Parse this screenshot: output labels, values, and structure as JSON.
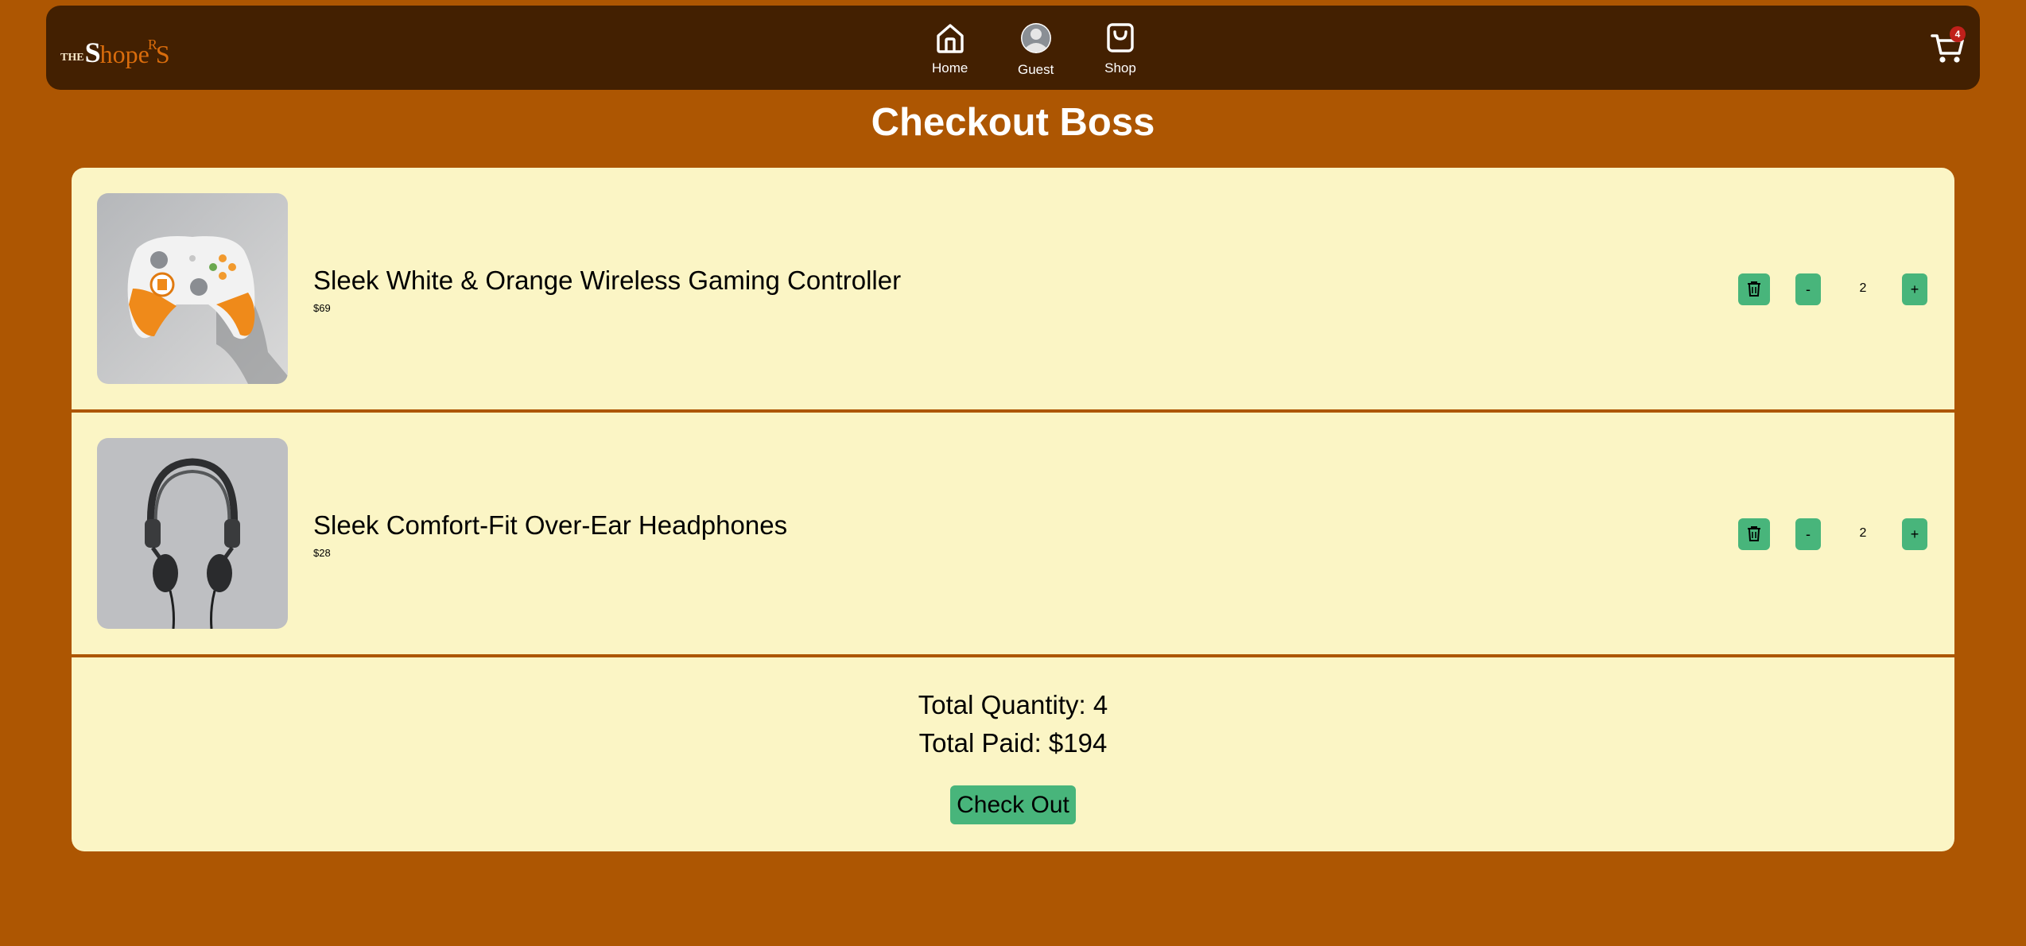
{
  "nav": {
    "logo": {
      "the": "THE",
      "s1": "S",
      "rest": "hope",
      "sup": "R",
      "s2": "S"
    },
    "items": [
      {
        "label": "Home",
        "icon": "home-icon"
      },
      {
        "label": "Guest",
        "icon": "user-avatar-icon"
      },
      {
        "label": "Shop",
        "icon": "shopping-bag-icon"
      }
    ],
    "cart": {
      "icon": "cart-icon",
      "badge": "4"
    }
  },
  "page_title": "Checkout Boss",
  "cart_items": [
    {
      "name": "Sleek White & Orange Wireless Gaming Controller",
      "price": "$69",
      "quantity": "2",
      "minus": "-",
      "plus": "+"
    },
    {
      "name": "Sleek Comfort-Fit Over-Ear Headphones",
      "price": "$28",
      "quantity": "2",
      "minus": "-",
      "plus": "+"
    }
  ],
  "summary": {
    "total_quantity": "Total Quantity: 4",
    "total_paid": "Total Paid: $194",
    "checkout_label": "Check Out"
  },
  "colors": {
    "background": "#ad5602",
    "navbar": "#432001",
    "panel": "#fbf5c5",
    "button": "#48b57b",
    "badge": "#c0201a"
  }
}
